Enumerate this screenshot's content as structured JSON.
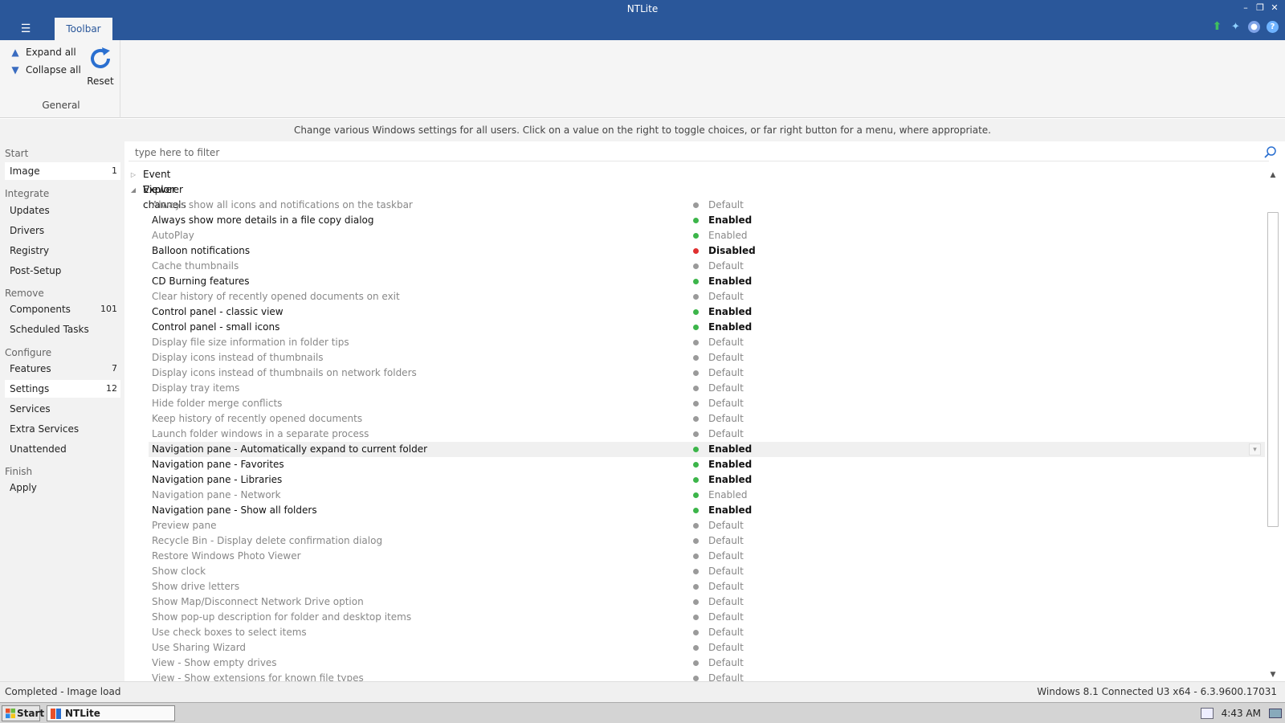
{
  "window": {
    "title": "NTLite",
    "tab_toolbar": "Toolbar"
  },
  "ribbon": {
    "expand_all": "Expand all",
    "collapse_all": "Collapse all",
    "reset": "Reset",
    "group_label": "General"
  },
  "info_text": "Change various Windows settings for all users. Click on a value on the right to toggle choices, or far right button for a menu, where appropriate.",
  "sidebar": {
    "sections": [
      {
        "label": "Start",
        "items": [
          {
            "label": "Image",
            "count": "1"
          }
        ]
      },
      {
        "label": "Integrate",
        "items": [
          {
            "label": "Updates"
          },
          {
            "label": "Drivers"
          },
          {
            "label": "Registry"
          },
          {
            "label": "Post-Setup"
          }
        ]
      },
      {
        "label": "Remove",
        "items": [
          {
            "label": "Components",
            "count": "101"
          },
          {
            "label": "Scheduled Tasks"
          }
        ]
      },
      {
        "label": "Configure",
        "items": [
          {
            "label": "Features",
            "count": "7"
          },
          {
            "label": "Settings",
            "count": "12"
          },
          {
            "label": "Services"
          },
          {
            "label": "Extra Services"
          },
          {
            "label": "Unattended"
          }
        ]
      },
      {
        "label": "Finish",
        "items": [
          {
            "label": "Apply"
          }
        ]
      }
    ]
  },
  "filter": {
    "placeholder": "type here to filter"
  },
  "tree": {
    "groups": [
      {
        "label": "Event Viewer channels",
        "expanded": false
      },
      {
        "label": "Explorer",
        "expanded": true
      }
    ],
    "rows": [
      {
        "name": "Always show all icons and notifications on the taskbar",
        "value": "Default",
        "state": "default"
      },
      {
        "name": "Always show more details in a file copy dialog",
        "value": "Enabled",
        "state": "enabled-set"
      },
      {
        "name": "AutoPlay",
        "value": "Enabled",
        "state": "enabled"
      },
      {
        "name": "Balloon notifications",
        "value": "Disabled",
        "state": "disabled-set"
      },
      {
        "name": "Cache thumbnails",
        "value": "Default",
        "state": "default"
      },
      {
        "name": "CD Burning features",
        "value": "Enabled",
        "state": "enabled-set"
      },
      {
        "name": "Clear history of recently opened documents on exit",
        "value": "Default",
        "state": "default"
      },
      {
        "name": "Control panel - classic view",
        "value": "Enabled",
        "state": "enabled-set"
      },
      {
        "name": "Control panel - small icons",
        "value": "Enabled",
        "state": "enabled-set"
      },
      {
        "name": "Display file size information in folder tips",
        "value": "Default",
        "state": "default"
      },
      {
        "name": "Display icons instead of thumbnails",
        "value": "Default",
        "state": "default"
      },
      {
        "name": "Display icons instead of thumbnails on network folders",
        "value": "Default",
        "state": "default"
      },
      {
        "name": "Display tray items",
        "value": "Default",
        "state": "default"
      },
      {
        "name": "Hide folder merge conflicts",
        "value": "Default",
        "state": "default"
      },
      {
        "name": "Keep history of recently opened documents",
        "value": "Default",
        "state": "default"
      },
      {
        "name": "Launch folder windows in a separate process",
        "value": "Default",
        "state": "default"
      },
      {
        "name": "Navigation pane - Automatically expand to current folder",
        "value": "Enabled",
        "state": "enabled-set",
        "hover": true
      },
      {
        "name": "Navigation pane - Favorites",
        "value": "Enabled",
        "state": "enabled-set"
      },
      {
        "name": "Navigation pane - Libraries",
        "value": "Enabled",
        "state": "enabled-set"
      },
      {
        "name": "Navigation pane - Network",
        "value": "Enabled",
        "state": "enabled"
      },
      {
        "name": "Navigation pane - Show all folders",
        "value": "Enabled",
        "state": "enabled-set"
      },
      {
        "name": "Preview pane",
        "value": "Default",
        "state": "default"
      },
      {
        "name": "Recycle Bin - Display delete confirmation dialog",
        "value": "Default",
        "state": "default"
      },
      {
        "name": "Restore Windows Photo Viewer",
        "value": "Default",
        "state": "default"
      },
      {
        "name": "Show clock",
        "value": "Default",
        "state": "default"
      },
      {
        "name": "Show drive letters",
        "value": "Default",
        "state": "default"
      },
      {
        "name": "Show Map/Disconnect Network Drive option",
        "value": "Default",
        "state": "default"
      },
      {
        "name": "Show pop-up description for folder and desktop items",
        "value": "Default",
        "state": "default"
      },
      {
        "name": "Use check boxes to select items",
        "value": "Default",
        "state": "default"
      },
      {
        "name": "Use Sharing Wizard",
        "value": "Default",
        "state": "default"
      },
      {
        "name": "View - Show empty drives",
        "value": "Default",
        "state": "default"
      },
      {
        "name": "View - Show extensions for known file types",
        "value": "Default",
        "state": "default"
      }
    ]
  },
  "colors": {
    "titlebar": "#2a579a",
    "dot_enabled": "#3cb54a",
    "dot_disabled": "#e03030",
    "dot_default": "#9a9a9a"
  },
  "status": {
    "left": "Completed - Image load",
    "right": "Windows 8.1 Connected U3 x64 - 6.3.9600.17031"
  },
  "taskbar": {
    "start": "Start",
    "app": "NTLite",
    "clock": "4:43 AM"
  }
}
